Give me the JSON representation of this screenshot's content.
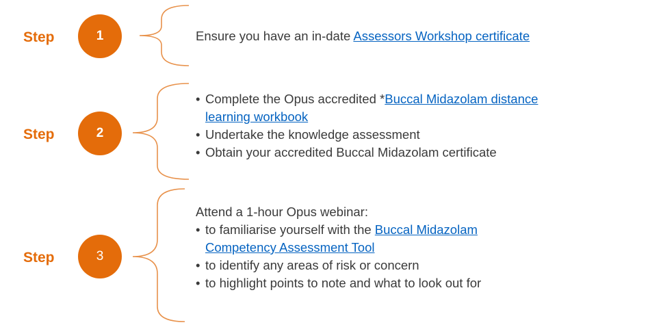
{
  "colors": {
    "accent": "#E46C0A",
    "text": "#3A3A3A",
    "link": "#0563C1",
    "bracket": "#E8914A"
  },
  "steps": [
    {
      "label": "Step",
      "number": "1",
      "intro": "Ensure you have an in-date ",
      "link": "Assessors Workshop certificate"
    },
    {
      "label": "Step",
      "number": "2",
      "bullets": {
        "b1_text": "Complete the Opus accredited *",
        "b1_link_part1": "Buccal Midazolam distance",
        "b1_link_part2": "learning workbook",
        "b2": "Undertake the knowledge assessment",
        "b3": "Obtain your accredited Buccal Midazolam certificate"
      }
    },
    {
      "label": "Step",
      "number": "3",
      "intro": "Attend a 1-hour Opus webinar:",
      "bullets": {
        "b1_text": "to familiarise yourself with the ",
        "b1_link_part1": "Buccal Midazolam",
        "b1_link_part2": "Competency Assessment Tool",
        "b2": "to identify any areas of risk or concern",
        "b3": "to highlight points to note and what to look out for"
      }
    }
  ]
}
